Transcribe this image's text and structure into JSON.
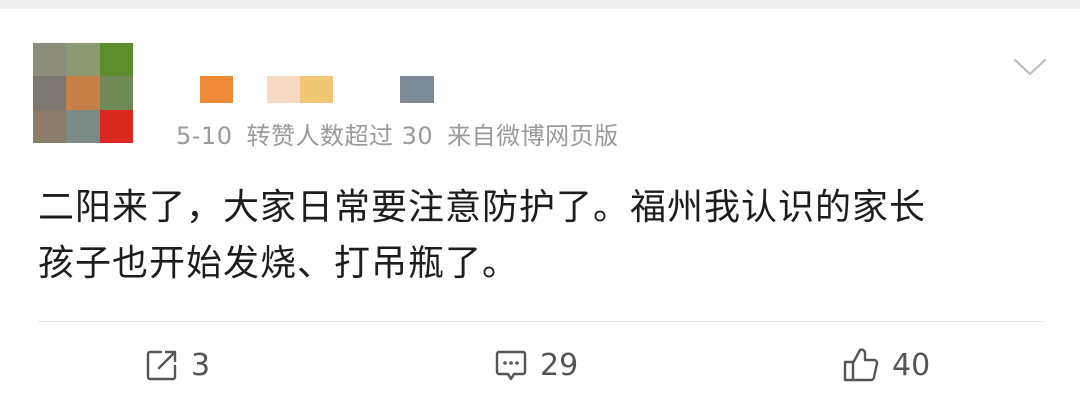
{
  "avatar": {
    "mosaic_colors": [
      "#8d8d7e",
      "#8b9a70",
      "#5d8d2e",
      "#7c7770",
      "#c68046",
      "#6f8a56",
      "#8a7c68",
      "#7c8a86",
      "#d9281d"
    ]
  },
  "username": {
    "mosaic_colors": [
      "#ef8a38",
      "#f7d9c3",
      "#f2c774",
      "#7e8996"
    ]
  },
  "post": {
    "date": "5-10",
    "reposts_note": "转赞人数超过 30",
    "source": "来自微博网页版",
    "text_line1": "二阳来了，大家日常要注意防护了。福州我认识的家长",
    "text_line2": "孩子也开始发烧、打吊瓶了。"
  },
  "actions": {
    "repost_count": "3",
    "comment_count": "29",
    "like_count": "40"
  },
  "icons": {
    "menu": "chevron-down-icon",
    "repost": "repost-icon",
    "comment": "comment-icon",
    "like": "thumbs-up-icon"
  },
  "colors": {
    "meta_text": "#9a9a9a",
    "body_text": "#1d1d1d",
    "action_text": "#555555"
  }
}
